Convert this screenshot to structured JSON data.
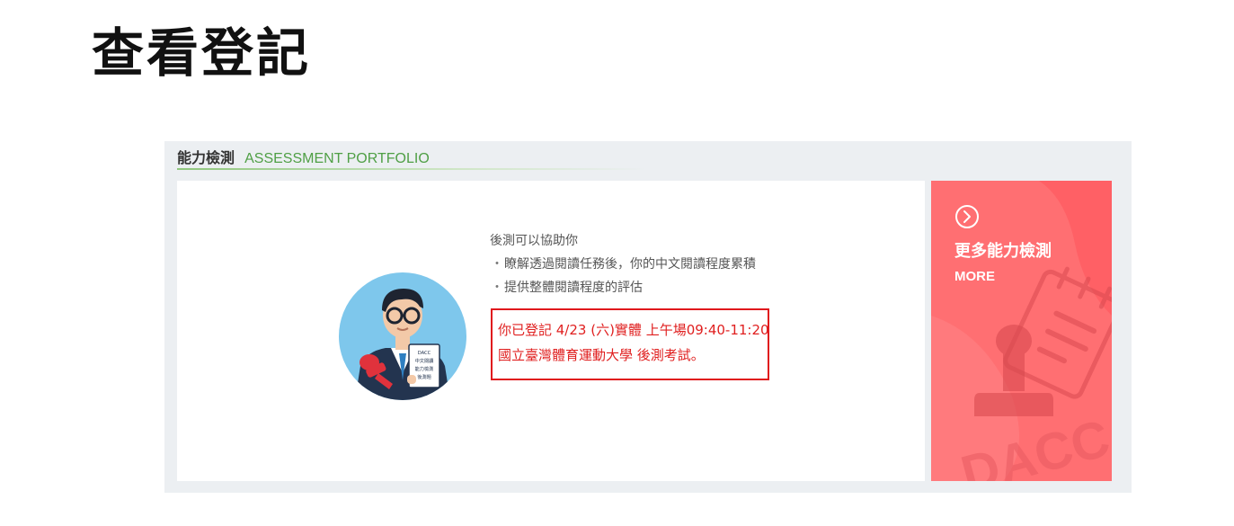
{
  "page": {
    "title": "查看登記"
  },
  "section": {
    "title_zh": "能力檢測",
    "title_en": "ASSESSMENT PORTFOLIO"
  },
  "info": {
    "intro": "後測可以協助你",
    "bullets": [
      "瞭解透過閱讀任務後，你的中文閱讀程度累積",
      "提供整體閱讀程度的評估"
    ],
    "bullet_marker": "・"
  },
  "notice": {
    "line1": "你已登記 4/23 (六)實體 上午場09:40-11:20",
    "line2": "國立臺灣體育運動大學 後測考試。"
  },
  "avatar": {
    "sign_lines": [
      "DACC",
      "中文閱讀",
      "能力檢測",
      "後測題"
    ]
  },
  "more": {
    "title": "更多能力檢測",
    "subtitle": "MORE",
    "watermark": "DACC"
  },
  "colors": {
    "accent_green": "#4f9f45",
    "notice_red": "#e0181d",
    "more_bg": "#ff6f72"
  },
  "icons": {
    "more_arrow": "chevron-right-circle-icon"
  }
}
